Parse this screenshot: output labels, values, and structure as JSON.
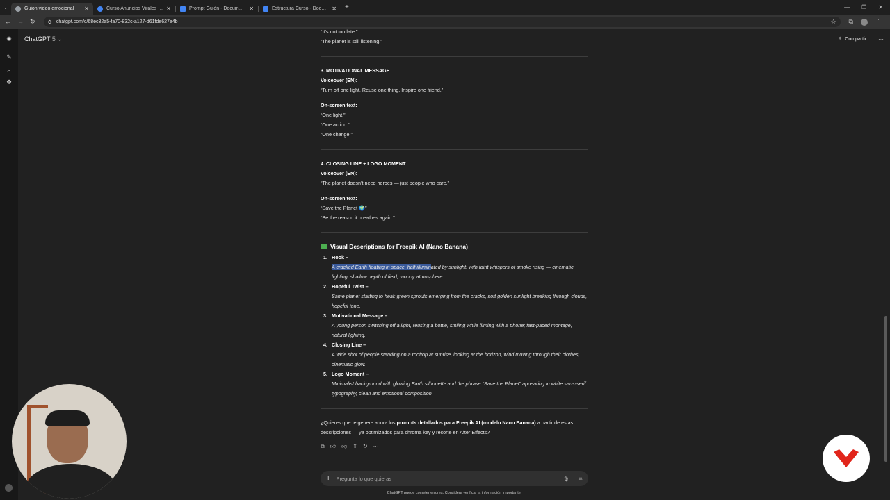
{
  "browser": {
    "tabs": [
      {
        "title": "Guion video emocional",
        "active": true,
        "color": "#9aa0a6"
      },
      {
        "title": "Curso Anuncios Virales - Googl...",
        "active": false,
        "color": "#4285f4"
      },
      {
        "title": "Prompt Guión - Documentos d...",
        "active": false,
        "color": "#4285f4"
      },
      {
        "title": "Estructura Curso - Documento...",
        "active": false,
        "color": "#4285f4"
      }
    ],
    "url": "chatgpt.com/c/68ec32a5-fa70-832c-a127-d61fde627e4b"
  },
  "header": {
    "model_name": "ChatGPT",
    "model_version": "5",
    "share_label": "Compartir"
  },
  "message": {
    "top_lines": [
      "“It’s not too late.”",
      "“The planet is still listening.”"
    ],
    "section3": {
      "title": "3. MOTIVATIONAL MESSAGE",
      "vo_label": "Voiceover (EN):",
      "vo_text": "“Turn off one light. Reuse one thing. Inspire one friend.”",
      "ost_label": "On-screen text:",
      "ost_lines": [
        "“One light.”",
        "“One action.”",
        "“One change.”"
      ]
    },
    "section4": {
      "title": "4. CLOSING LINE + LOGO MOMENT",
      "vo_label": "Voiceover (EN):",
      "vo_text": "“The planet doesn’t need heroes — just people who care.”",
      "ost_label": "On-screen text:",
      "ost_lines": [
        "“Save the Planet 🌍”",
        "“Be the reason it breathes again.”"
      ]
    },
    "visual": {
      "title": "Visual Descriptions for Freepik AI (Nano Banana)",
      "items": [
        {
          "num": "1.",
          "label": "Hook –",
          "desc_highlight": "A cracked Earth floating in space, half illumin",
          "desc": "ated by sunlight, with faint whispers of smoke rising — cinematic lighting, shallow depth of field, moody atmosphere."
        },
        {
          "num": "2.",
          "label": "Hopeful Twist –",
          "desc_highlight": "",
          "desc": "Same planet starting to heal: green sprouts emerging from the cracks, soft golden sunlight breaking through clouds, hopeful tone."
        },
        {
          "num": "3.",
          "label": "Motivational Message –",
          "desc_highlight": "",
          "desc": "A young person switching off a light, reusing a bottle, smiling while filming with a phone; fast-paced montage, natural lighting."
        },
        {
          "num": "4.",
          "label": "Closing Line –",
          "desc_highlight": "",
          "desc": "A wide shot of people standing on a rooftop at sunrise, looking at the horizon, wind moving through their clothes, cinematic glow."
        },
        {
          "num": "5.",
          "label": "Logo Moment –",
          "desc_highlight": "",
          "desc": "Minimalist background with glowing Earth silhouette and the phrase “Save the Planet” appearing in white sans-serif typography, clean and emotional composition."
        }
      ]
    },
    "followup_pre": "¿Quieres que te genere ahora los ",
    "followup_bold": "prompts detallados para Freepik AI (modelo Nano Banana)",
    "followup_post": " a partir de estas descripciones — ya optimizados para chroma key y recorte en After Effects?"
  },
  "composer": {
    "placeholder": "Pregunta lo que quieras"
  },
  "disclaimer": "ChatGPT puede cometer errores. Considera verificar la información importante.",
  "colors": {
    "logo_red": "#e1251b",
    "highlight": "#3a5a9a"
  }
}
